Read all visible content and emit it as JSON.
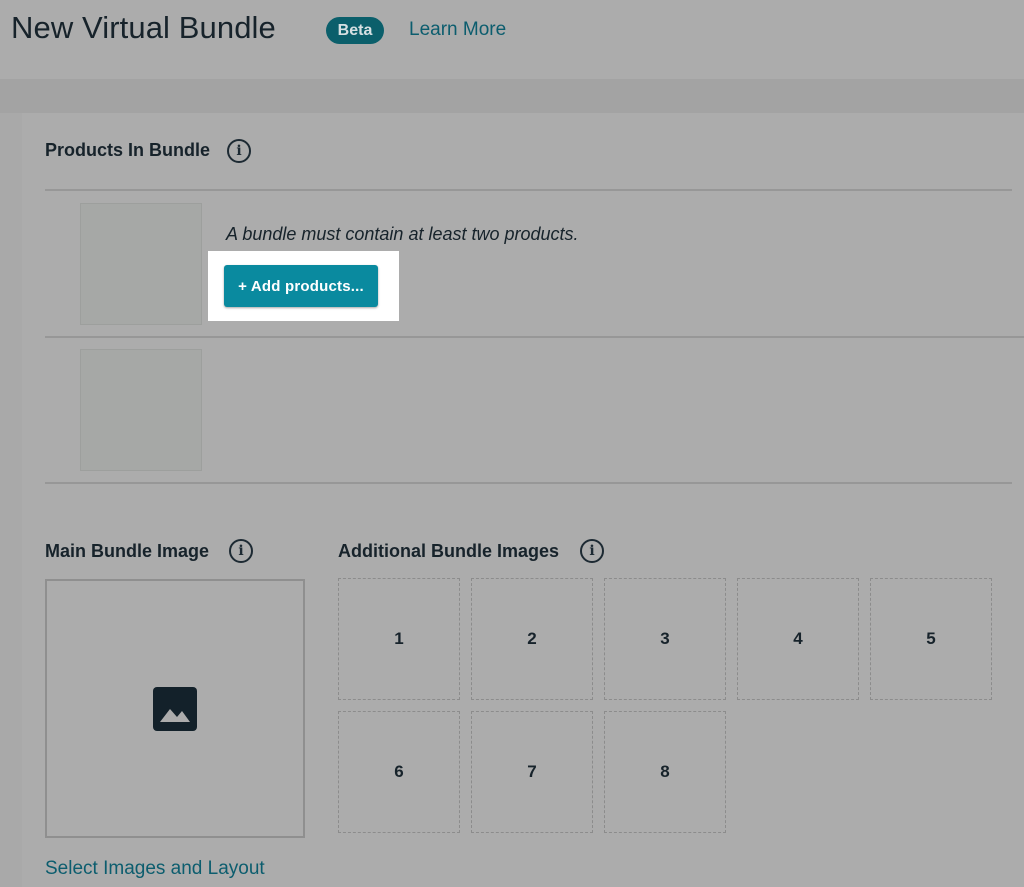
{
  "header": {
    "title": "New Virtual Bundle",
    "badge": "Beta",
    "learn_more": "Learn More"
  },
  "products_section": {
    "title": "Products In Bundle",
    "note": "A bundle must contain at least two products.",
    "add_button": "+ Add products..."
  },
  "images_section": {
    "main_title": "Main Bundle Image",
    "additional_title": "Additional Bundle Images",
    "main_icon": "image-icon",
    "slots": [
      "1",
      "2",
      "3",
      "4",
      "5",
      "6",
      "7",
      "8"
    ],
    "select_link": "Select Images and Layout"
  },
  "colors": {
    "accent": "#0a8a9f",
    "link": "#0c5d6e",
    "badge": "#0b5f6b",
    "overlay_bg": "#acacac"
  }
}
